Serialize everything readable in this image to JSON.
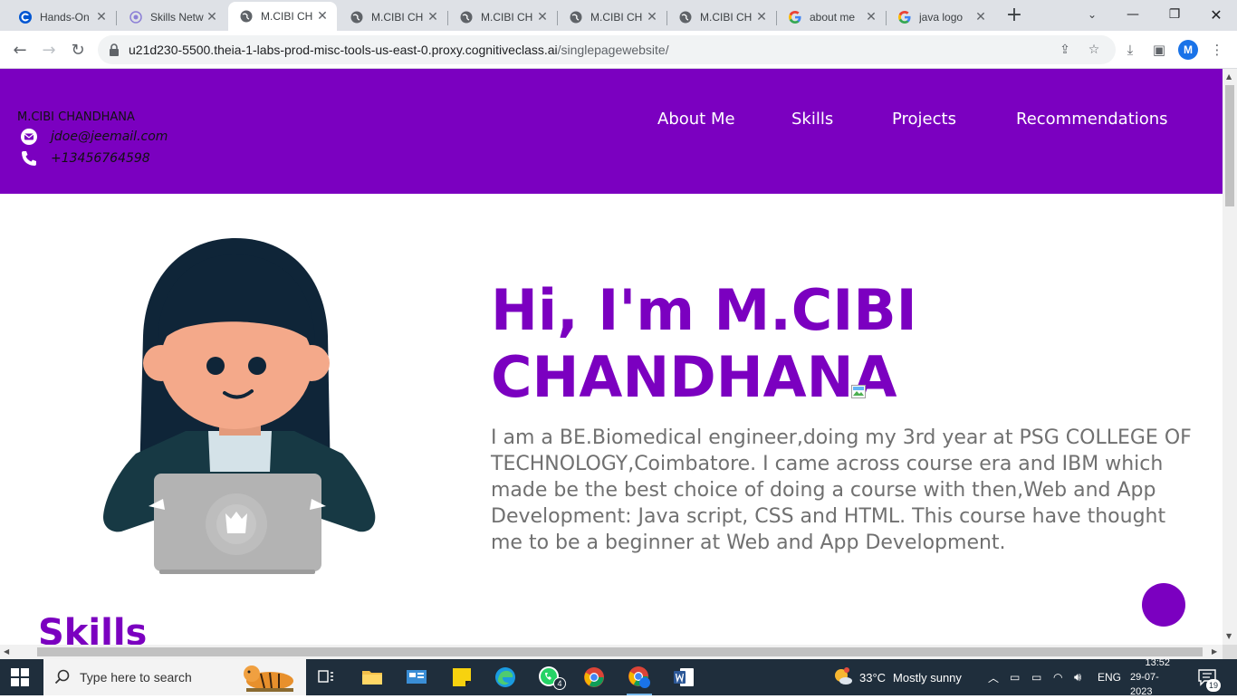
{
  "browser": {
    "tabs": [
      {
        "label": "Hands-On",
        "icon": "coursera-icon",
        "active": false
      },
      {
        "label": "Skills Netw",
        "icon": "skills-network-icon",
        "active": false
      },
      {
        "label": "M.CIBI CH",
        "icon": "globe-icon",
        "active": true
      },
      {
        "label": "M.CIBI CH",
        "icon": "globe-icon",
        "active": false
      },
      {
        "label": "M.CIBI CH",
        "icon": "globe-icon",
        "active": false
      },
      {
        "label": "M.CIBI CH",
        "icon": "globe-icon",
        "active": false
      },
      {
        "label": "M.CIBI CH",
        "icon": "globe-icon",
        "active": false
      },
      {
        "label": "about me",
        "icon": "google-icon",
        "active": false
      },
      {
        "label": "java logo",
        "icon": "google-icon",
        "active": false
      }
    ],
    "url_host": "u21d230-5500.theia-1-labs-prod-misc-tools-us-east-0.proxy.cognitiveclass.ai",
    "url_path": "/singlepagewebsite/",
    "profile_initial": "M"
  },
  "site": {
    "name": "M.CIBI CHANDHANA",
    "email": "jdoe@jeemail.com",
    "phone": "+13456764598",
    "nav": [
      "About Me",
      "Skills",
      "Projects",
      "Recommendations"
    ],
    "hero_title": "Hi, I'm M.CIBI CHANDHANA",
    "hero_text": "I am a BE.Biomedical engineer,doing my 3rd year at PSG COLLEGE OF TECHNOLOGY,Coimbatore. I came across course era and IBM which made be the best choice of doing a course with then,Web and App Development: Java script, CSS and HTML. This course have thought me to be a beginner at Web and App Development.",
    "skills_heading": "Skills",
    "accent_color": "#7b00c0"
  },
  "taskbar": {
    "search_placeholder": "Type here to search",
    "whatsapp_badge": "4",
    "weather_temp": "33°C",
    "weather_text": "Mostly sunny",
    "language": "ENG",
    "time": "13:52",
    "date": "29-07-2023",
    "notification_count": "19"
  }
}
